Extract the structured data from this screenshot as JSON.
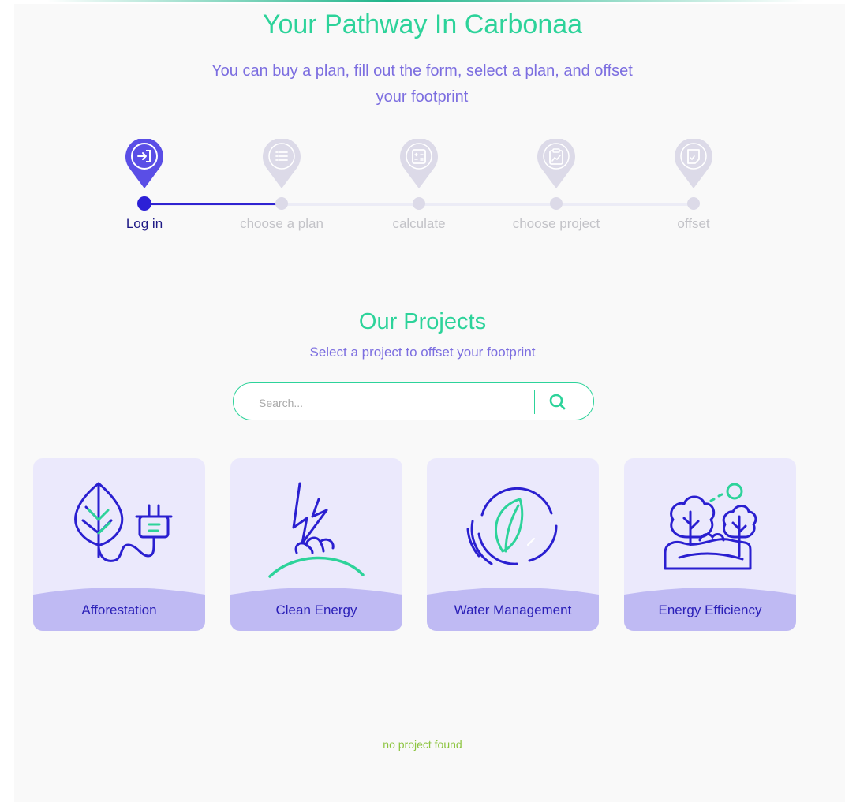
{
  "header": {
    "title": "Your Pathway In Carbonaa",
    "subtitle": "You can buy a plan, fill out the form, select a plan, and offset your footprint"
  },
  "steps": [
    {
      "label": "Log in",
      "icon": "login-icon",
      "active": true
    },
    {
      "label": "choose a plan",
      "icon": "list-icon",
      "active": false
    },
    {
      "label": "calculate",
      "icon": "calculator-icon",
      "active": false
    },
    {
      "label": "choose project",
      "icon": "clipboard-chart-icon",
      "active": false
    },
    {
      "label": "offset",
      "icon": "document-check-icon",
      "active": false
    }
  ],
  "projects_section": {
    "title": "Our Projects",
    "subtitle": "Select a project to offset your footprint",
    "search": {
      "placeholder": "Search...",
      "value": ""
    },
    "cards": [
      {
        "label": "Afforestation",
        "icon": "leaf-plug-icon"
      },
      {
        "label": "Clean Energy",
        "icon": "lightning-ground-icon"
      },
      {
        "label": "Water Management",
        "icon": "water-leaf-circle-icon"
      },
      {
        "label": "Energy Efficiency",
        "icon": "trees-landscape-icon"
      }
    ],
    "empty_message": "no project found"
  },
  "colors": {
    "accent_green": "#2dd39a",
    "accent_purple": "#7c6ee0",
    "primary_blue": "#2c20d6",
    "card_bg": "#ebe9fc",
    "card_base": "#bfbaf3",
    "empty_text": "#8cc43f"
  }
}
